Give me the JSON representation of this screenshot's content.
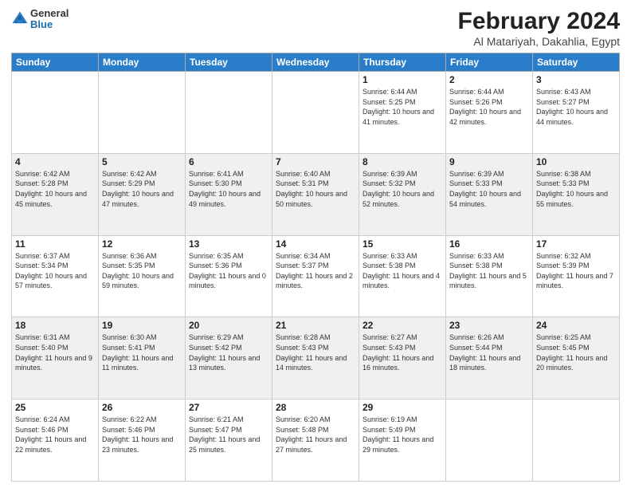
{
  "header": {
    "logo_general": "General",
    "logo_blue": "Blue",
    "title": "February 2024",
    "location": "Al Matariyah, Dakahlia, Egypt"
  },
  "days_of_week": [
    "Sunday",
    "Monday",
    "Tuesday",
    "Wednesday",
    "Thursday",
    "Friday",
    "Saturday"
  ],
  "weeks": [
    [
      {
        "day": "",
        "info": ""
      },
      {
        "day": "",
        "info": ""
      },
      {
        "day": "",
        "info": ""
      },
      {
        "day": "",
        "info": ""
      },
      {
        "day": "1",
        "info": "Sunrise: 6:44 AM\nSunset: 5:25 PM\nDaylight: 10 hours and 41 minutes."
      },
      {
        "day": "2",
        "info": "Sunrise: 6:44 AM\nSunset: 5:26 PM\nDaylight: 10 hours and 42 minutes."
      },
      {
        "day": "3",
        "info": "Sunrise: 6:43 AM\nSunset: 5:27 PM\nDaylight: 10 hours and 44 minutes."
      }
    ],
    [
      {
        "day": "4",
        "info": "Sunrise: 6:42 AM\nSunset: 5:28 PM\nDaylight: 10 hours and 45 minutes."
      },
      {
        "day": "5",
        "info": "Sunrise: 6:42 AM\nSunset: 5:29 PM\nDaylight: 10 hours and 47 minutes."
      },
      {
        "day": "6",
        "info": "Sunrise: 6:41 AM\nSunset: 5:30 PM\nDaylight: 10 hours and 49 minutes."
      },
      {
        "day": "7",
        "info": "Sunrise: 6:40 AM\nSunset: 5:31 PM\nDaylight: 10 hours and 50 minutes."
      },
      {
        "day": "8",
        "info": "Sunrise: 6:39 AM\nSunset: 5:32 PM\nDaylight: 10 hours and 52 minutes."
      },
      {
        "day": "9",
        "info": "Sunrise: 6:39 AM\nSunset: 5:33 PM\nDaylight: 10 hours and 54 minutes."
      },
      {
        "day": "10",
        "info": "Sunrise: 6:38 AM\nSunset: 5:33 PM\nDaylight: 10 hours and 55 minutes."
      }
    ],
    [
      {
        "day": "11",
        "info": "Sunrise: 6:37 AM\nSunset: 5:34 PM\nDaylight: 10 hours and 57 minutes."
      },
      {
        "day": "12",
        "info": "Sunrise: 6:36 AM\nSunset: 5:35 PM\nDaylight: 10 hours and 59 minutes."
      },
      {
        "day": "13",
        "info": "Sunrise: 6:35 AM\nSunset: 5:36 PM\nDaylight: 11 hours and 0 minutes."
      },
      {
        "day": "14",
        "info": "Sunrise: 6:34 AM\nSunset: 5:37 PM\nDaylight: 11 hours and 2 minutes."
      },
      {
        "day": "15",
        "info": "Sunrise: 6:33 AM\nSunset: 5:38 PM\nDaylight: 11 hours and 4 minutes."
      },
      {
        "day": "16",
        "info": "Sunrise: 6:33 AM\nSunset: 5:38 PM\nDaylight: 11 hours and 5 minutes."
      },
      {
        "day": "17",
        "info": "Sunrise: 6:32 AM\nSunset: 5:39 PM\nDaylight: 11 hours and 7 minutes."
      }
    ],
    [
      {
        "day": "18",
        "info": "Sunrise: 6:31 AM\nSunset: 5:40 PM\nDaylight: 11 hours and 9 minutes."
      },
      {
        "day": "19",
        "info": "Sunrise: 6:30 AM\nSunset: 5:41 PM\nDaylight: 11 hours and 11 minutes."
      },
      {
        "day": "20",
        "info": "Sunrise: 6:29 AM\nSunset: 5:42 PM\nDaylight: 11 hours and 13 minutes."
      },
      {
        "day": "21",
        "info": "Sunrise: 6:28 AM\nSunset: 5:43 PM\nDaylight: 11 hours and 14 minutes."
      },
      {
        "day": "22",
        "info": "Sunrise: 6:27 AM\nSunset: 5:43 PM\nDaylight: 11 hours and 16 minutes."
      },
      {
        "day": "23",
        "info": "Sunrise: 6:26 AM\nSunset: 5:44 PM\nDaylight: 11 hours and 18 minutes."
      },
      {
        "day": "24",
        "info": "Sunrise: 6:25 AM\nSunset: 5:45 PM\nDaylight: 11 hours and 20 minutes."
      }
    ],
    [
      {
        "day": "25",
        "info": "Sunrise: 6:24 AM\nSunset: 5:46 PM\nDaylight: 11 hours and 22 minutes."
      },
      {
        "day": "26",
        "info": "Sunrise: 6:22 AM\nSunset: 5:46 PM\nDaylight: 11 hours and 23 minutes."
      },
      {
        "day": "27",
        "info": "Sunrise: 6:21 AM\nSunset: 5:47 PM\nDaylight: 11 hours and 25 minutes."
      },
      {
        "day": "28",
        "info": "Sunrise: 6:20 AM\nSunset: 5:48 PM\nDaylight: 11 hours and 27 minutes."
      },
      {
        "day": "29",
        "info": "Sunrise: 6:19 AM\nSunset: 5:49 PM\nDaylight: 11 hours and 29 minutes."
      },
      {
        "day": "",
        "info": ""
      },
      {
        "day": "",
        "info": ""
      }
    ]
  ]
}
